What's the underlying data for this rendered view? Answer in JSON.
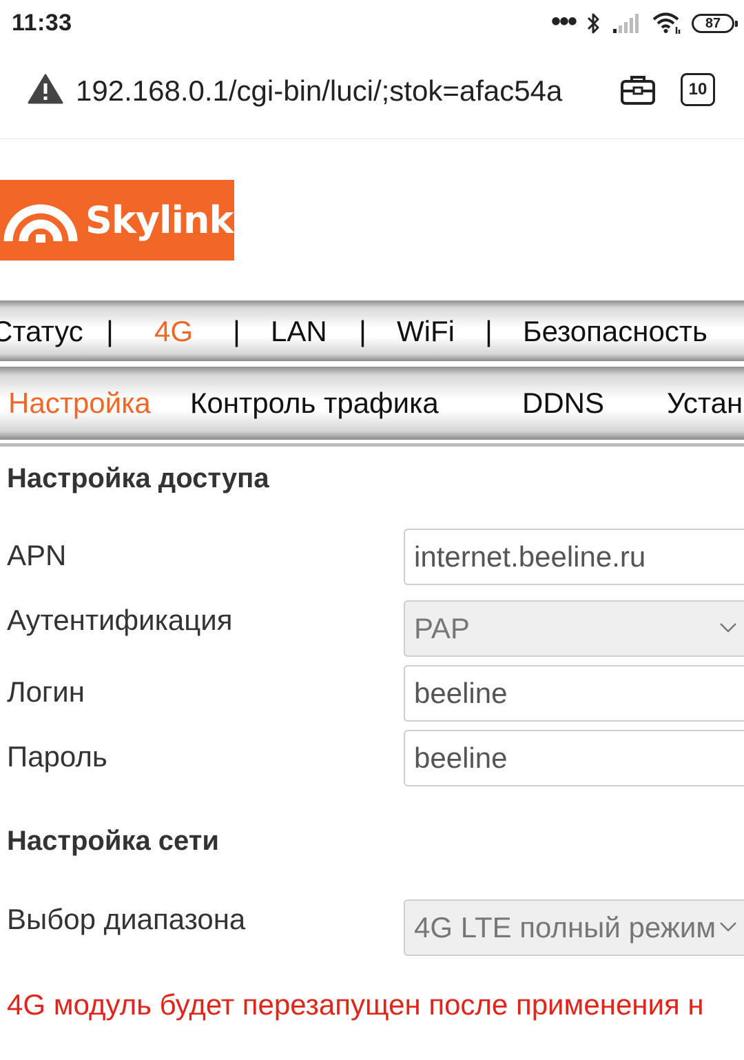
{
  "status_bar": {
    "time": "11:33",
    "more_icon": "•••",
    "battery": "87"
  },
  "browser": {
    "url": "192.168.0.1/cgi-bin/luci/;stok=afac54a",
    "tab_count": "10"
  },
  "brand": {
    "name": "Skylink",
    "color": "#f26727"
  },
  "main_menu": {
    "items": [
      "Статус",
      "4G",
      "LAN",
      "WiFi",
      "Безопасность"
    ],
    "separator": "|",
    "active": "4G"
  },
  "sub_menu": {
    "items": [
      "Настройка",
      "Контроль трафика",
      "DDNS",
      "Устан"
    ],
    "active": "Настройка"
  },
  "access": {
    "title": "Настройка доступа",
    "apn_label": "APN",
    "apn_value": "internet.beeline.ru",
    "auth_label": "Аутентификация",
    "auth_value": "PAP",
    "login_label": "Логин",
    "login_value": "beeline",
    "password_label": "Пароль",
    "password_value": "beeline"
  },
  "network": {
    "title": "Настройка сети",
    "band_label": "Выбор диапазона",
    "band_value": "4G LTE полный режим"
  },
  "notice": {
    "text": "4G модуль будет перезапущен после применения н",
    "color": "#e1251b"
  }
}
